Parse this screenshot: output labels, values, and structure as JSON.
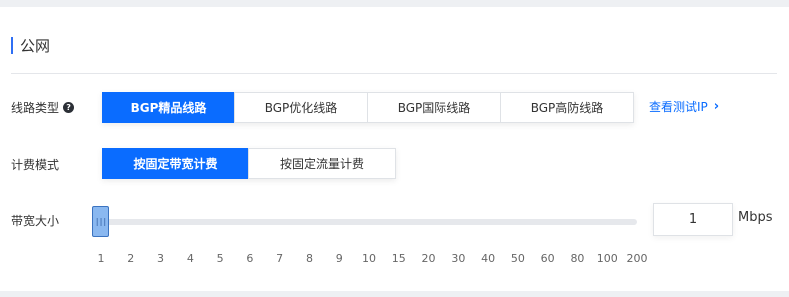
{
  "section": {
    "title": "公网"
  },
  "line_type": {
    "label": "线路类型",
    "help_glyph": "?",
    "options": [
      "BGP精品线路",
      "BGP优化线路",
      "BGP国际线路",
      "BGP高防线路"
    ],
    "selected": "BGP精品线路",
    "link_text": "查看测试IP",
    "link_glyph": "›"
  },
  "billing": {
    "label": "计费模式",
    "options": [
      "按固定带宽计费",
      "按固定流量计费"
    ],
    "selected": "按固定带宽计费"
  },
  "bandwidth": {
    "label": "带宽大小",
    "value": "1",
    "unit": "Mbps",
    "slider_value": 1,
    "handle_glyph": "|||",
    "ticks": [
      "1",
      "2",
      "3",
      "4",
      "5",
      "6",
      "7",
      "8",
      "9",
      "10",
      "15",
      "20",
      "30",
      "40",
      "50",
      "60",
      "80",
      "100",
      "200"
    ]
  },
  "colors": {
    "accent": "#0a6cff",
    "title_bar": "#2f6ff4",
    "handle": "#8ab8f0"
  }
}
